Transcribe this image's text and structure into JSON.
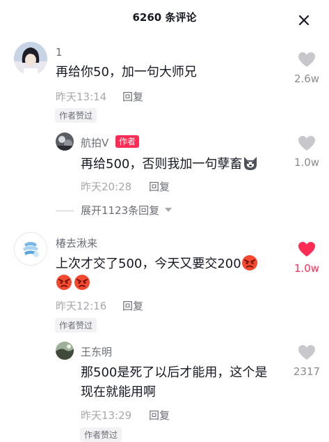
{
  "header": {
    "title": "6260 条评论"
  },
  "comments": [
    {
      "username": "1",
      "text": "再给你50，加一句大师兄",
      "time": "昨天13:14",
      "reply_label": "回复",
      "liked_tag": "作者赞过",
      "likes": "2.6w",
      "sub_reply": {
        "username": "航拍V",
        "badge": "作者",
        "text": "再给500，否则我加一句孽畜",
        "time": "昨天20:28",
        "reply_label": "回复",
        "likes": "1.0w"
      },
      "expand_label": "展开1123条回复"
    },
    {
      "username": "椿去湫来",
      "text_line1": "上次才交了500，今天又要交200",
      "time": "昨天12:16",
      "reply_label": "回复",
      "liked_tag": "作者赞过",
      "likes": "1.0w",
      "liked": true,
      "sub_reply": {
        "username": "王东明",
        "text_line1": "那500是死了以后才能用，这个是",
        "text_line2": "现在就能用啊",
        "time": "昨天13:29",
        "reply_label": "回复",
        "liked_tag": "作者赞过",
        "likes": "2317"
      }
    }
  ],
  "colors": {
    "accent": "#fe2c55",
    "text_primary": "#161823",
    "text_secondary": "#a6a8ad",
    "heart_default": "#c7c7cc"
  },
  "icons": [
    "close-icon",
    "heart-icon",
    "angry-emoji-icon",
    "husky-emoji-icon",
    "chevron-down-icon"
  ]
}
